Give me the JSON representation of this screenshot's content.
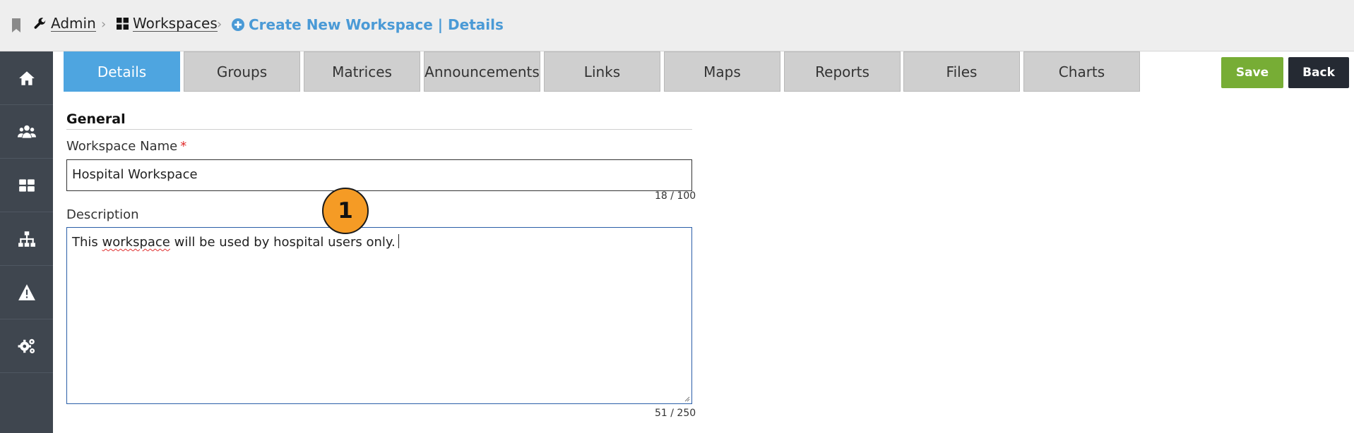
{
  "breadcrumb": {
    "admin": "Admin",
    "workspaces": "Workspaces",
    "current": "Create New Workspace | Details"
  },
  "sidebar": {
    "items": [
      {
        "icon": "home-icon"
      },
      {
        "icon": "users-icon"
      },
      {
        "icon": "workspaces-grid-icon"
      },
      {
        "icon": "hierarchy-icon"
      },
      {
        "icon": "warning-icon"
      },
      {
        "icon": "settings-gears-icon"
      }
    ]
  },
  "tabs": [
    {
      "label": "Details",
      "active": true
    },
    {
      "label": "Groups"
    },
    {
      "label": "Matrices"
    },
    {
      "label": "Announcements"
    },
    {
      "label": "Links"
    },
    {
      "label": "Maps"
    },
    {
      "label": "Reports"
    },
    {
      "label": "Files"
    },
    {
      "label": "Charts"
    }
  ],
  "actions": {
    "save": "Save",
    "back": "Back"
  },
  "form": {
    "section_title": "General",
    "name_label": "Workspace Name",
    "required_mark": "*",
    "name_value": "Hospital Workspace",
    "name_counter": "18 / 100",
    "description_label": "Description",
    "description_before": "This ",
    "description_misspelled": "workspace",
    "description_after": " will be used by hospital users only.",
    "description_counter": "51 / 250"
  },
  "callout": {
    "number": "1"
  },
  "colors": {
    "active_tab": "#4ea5e0",
    "save_button": "#77ad35",
    "back_button": "#252a33",
    "sidebar": "#3f464f",
    "breadcrumb_current": "#4a9ad6",
    "callout": "#f59b25"
  }
}
